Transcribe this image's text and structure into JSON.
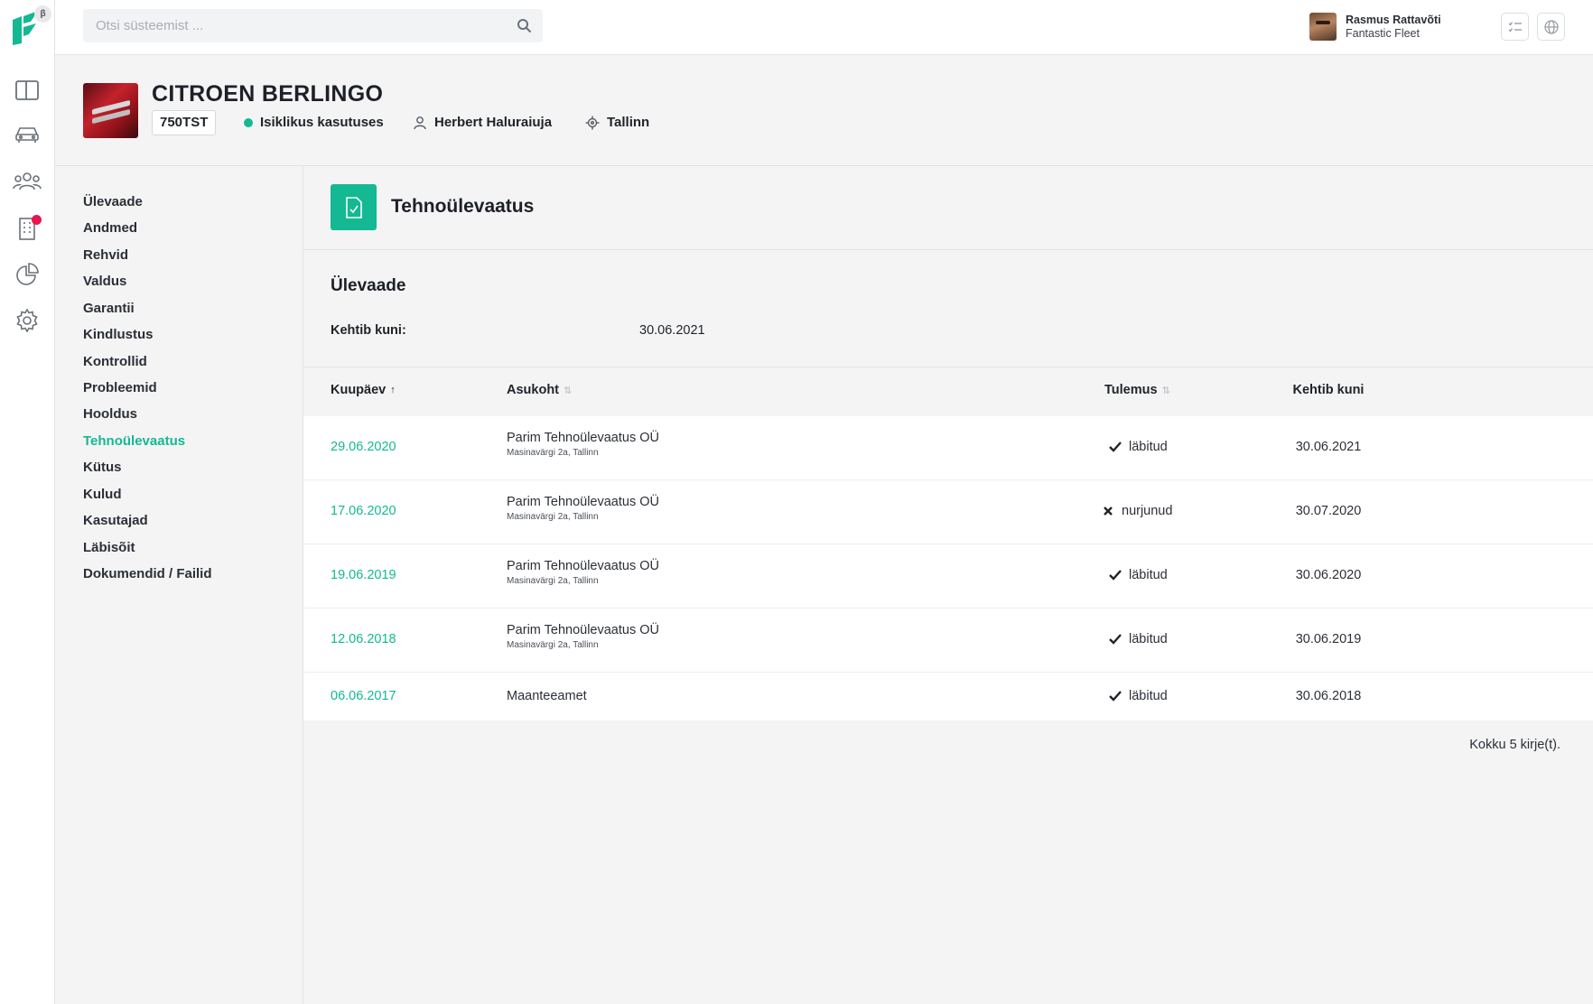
{
  "search": {
    "placeholder": "Otsi süsteemist ..."
  },
  "logo": {
    "beta": "β"
  },
  "user": {
    "name": "Rasmus Rattavõti",
    "org": "Fantastic Fleet"
  },
  "vehicle": {
    "title": "CITROEN BERLINGO",
    "plate": "750TST",
    "status": "Isiklikus kasutuses",
    "status_color": "#14b893",
    "driver": "Herbert Haluraiuja",
    "location": "Tallinn"
  },
  "nav": [
    "Ülevaade",
    "Andmed",
    "Rehvid",
    "Valdus",
    "Garantii",
    "Kindlustus",
    "Kontrollid",
    "Probleemid",
    "Hooldus",
    "Tehnoülevaatus",
    "Kütus",
    "Kulud",
    "Kasutajad",
    "Läbisõit",
    "Dokumendid / Failid"
  ],
  "active_nav": "Tehnoülevaatus",
  "panel": {
    "title": "Tehnoülevaatus"
  },
  "overview": {
    "title": "Ülevaade",
    "valid_label": "Kehtib kuni:",
    "valid_value": "30.06.2021"
  },
  "table": {
    "headers": {
      "date": "Kuupäev",
      "location": "Asukoht",
      "result": "Tulemus",
      "valid": "Kehtib kuni"
    },
    "rows": [
      {
        "date": "29.06.2020",
        "location": "Parim Tehnoülevaatus OÜ",
        "address": "Masinavärgi 2a, Tallinn",
        "result": "läbitud",
        "passed": true,
        "valid": "30.06.2021"
      },
      {
        "date": "17.06.2020",
        "location": "Parim Tehnoülevaatus OÜ",
        "address": "Masinavärgi 2a, Tallinn",
        "result": "nurjunud",
        "passed": false,
        "valid": "30.07.2020"
      },
      {
        "date": "19.06.2019",
        "location": "Parim Tehnoülevaatus OÜ",
        "address": "Masinavärgi 2a, Tallinn",
        "result": "läbitud",
        "passed": true,
        "valid": "30.06.2020"
      },
      {
        "date": "12.06.2018",
        "location": "Parim Tehnoülevaatus OÜ",
        "address": "Masinavärgi 2a, Tallinn",
        "result": "läbitud",
        "passed": true,
        "valid": "30.06.2019"
      },
      {
        "date": "06.06.2017",
        "location": "Maanteeamet",
        "address": "",
        "result": "läbitud",
        "passed": true,
        "valid": "30.06.2018"
      }
    ],
    "total": "Kokku 5 kirje(t)."
  },
  "colors": {
    "accent": "#14b893",
    "notification": "#e8174f"
  }
}
